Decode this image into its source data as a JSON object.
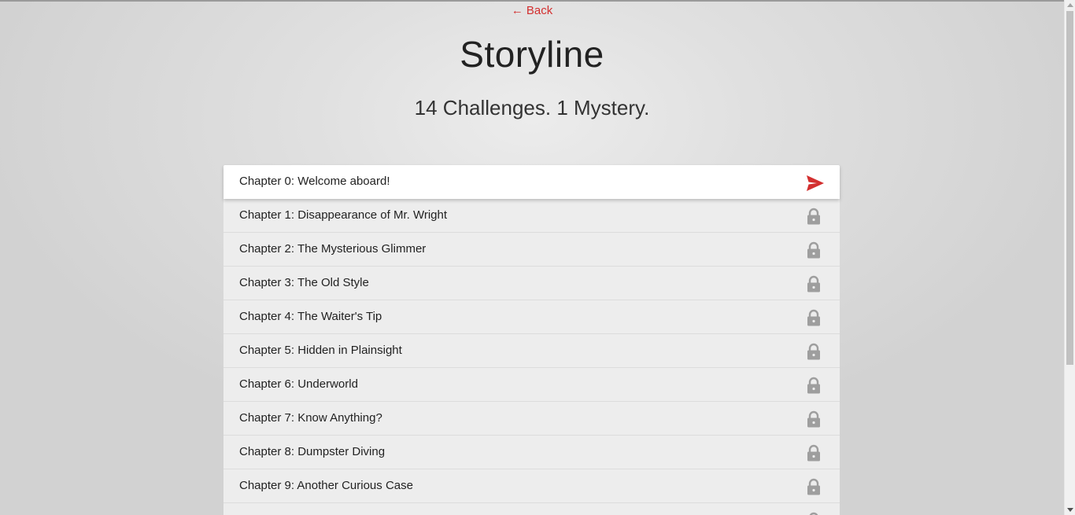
{
  "nav": {
    "back_label": "← Back"
  },
  "header": {
    "title": "Storyline",
    "subtitle": "14 Challenges. 1 Mystery."
  },
  "colors": {
    "accent": "#d32f2f",
    "lock": "#9e9e9e"
  },
  "chapters": [
    {
      "label": "Chapter 0: Welcome aboard!",
      "icon": "send-icon",
      "state": "active"
    },
    {
      "label": "Chapter 1: Disappearance of Mr. Wright",
      "icon": "lock-icon",
      "state": "locked"
    },
    {
      "label": "Chapter 2: The Mysterious Glimmer",
      "icon": "lock-icon",
      "state": "locked"
    },
    {
      "label": "Chapter 3: The Old Style",
      "icon": "lock-icon",
      "state": "locked"
    },
    {
      "label": "Chapter 4: The Waiter's Tip",
      "icon": "lock-icon",
      "state": "locked"
    },
    {
      "label": "Chapter 5: Hidden in Plainsight",
      "icon": "lock-icon",
      "state": "locked"
    },
    {
      "label": "Chapter 6: Underworld",
      "icon": "lock-icon",
      "state": "locked"
    },
    {
      "label": "Chapter 7: Know Anything?",
      "icon": "lock-icon",
      "state": "locked"
    },
    {
      "label": "Chapter 8: Dumpster Diving",
      "icon": "lock-icon",
      "state": "locked"
    },
    {
      "label": "Chapter 9: Another Curious Case",
      "icon": "lock-icon",
      "state": "locked"
    },
    {
      "label": "",
      "icon": "lock-icon",
      "state": "locked"
    }
  ]
}
